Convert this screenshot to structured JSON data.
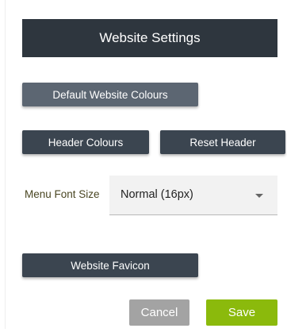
{
  "header": {
    "title": "Website Settings"
  },
  "buttons": {
    "default_colours": "Default Website Colours",
    "header_colours": "Header Colours",
    "reset_header": "Reset Header",
    "website_favicon": "Website Favicon"
  },
  "menu_font_size": {
    "label": "Menu Font Size",
    "selected_value": "Normal (16px)"
  },
  "footer": {
    "cancel_label": "Cancel",
    "save_label": "Save"
  },
  "colors": {
    "header_bg": "#2e363e",
    "dark_button": "#3b4550",
    "muted_button": "#5c6672",
    "cancel_button": "#a3a3a3",
    "save_button": "#8bba0c",
    "label_text": "#4a4622"
  }
}
